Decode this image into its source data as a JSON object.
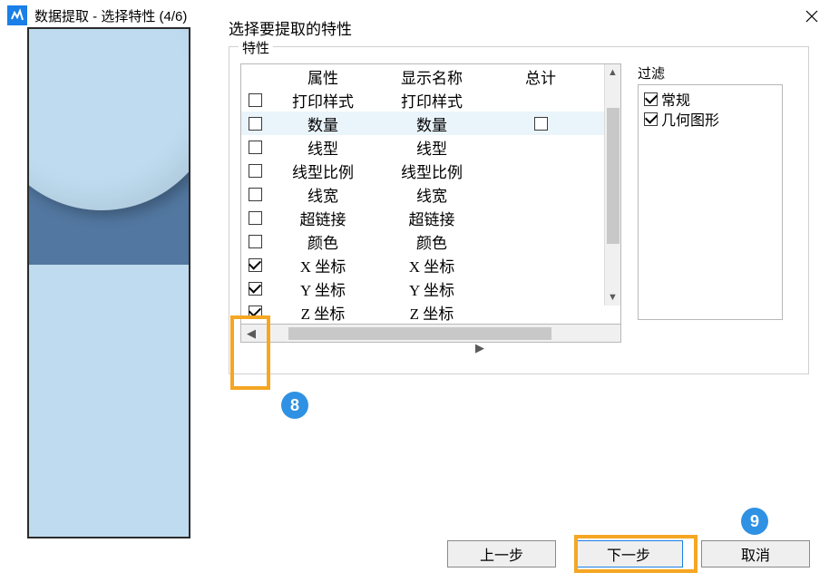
{
  "window": {
    "title": "数据提取 - 选择特性 (4/6)"
  },
  "instruction": "选择要提取的特性",
  "group_label": "特性",
  "table": {
    "headers": {
      "attr": "属性",
      "display": "显示名称",
      "total": "总计"
    },
    "rows": [
      {
        "checked": false,
        "attr": "打印样式",
        "display": "打印样式",
        "highlight": false,
        "show_total_box": false
      },
      {
        "checked": false,
        "attr": "数量",
        "display": "数量",
        "highlight": true,
        "show_total_box": true
      },
      {
        "checked": false,
        "attr": "线型",
        "display": "线型",
        "highlight": false,
        "show_total_box": false
      },
      {
        "checked": false,
        "attr": "线型比例",
        "display": "线型比例",
        "highlight": false,
        "show_total_box": false
      },
      {
        "checked": false,
        "attr": "线宽",
        "display": "线宽",
        "highlight": false,
        "show_total_box": false
      },
      {
        "checked": false,
        "attr": "超链接",
        "display": "超链接",
        "highlight": false,
        "show_total_box": false
      },
      {
        "checked": false,
        "attr": "颜色",
        "display": "颜色",
        "highlight": false,
        "show_total_box": false
      },
      {
        "checked": true,
        "attr": "X 坐标",
        "display": "X 坐标",
        "highlight": false,
        "show_total_box": false
      },
      {
        "checked": true,
        "attr": "Y 坐标",
        "display": "Y 坐标",
        "highlight": false,
        "show_total_box": false
      },
      {
        "checked": true,
        "attr": "Z 坐标",
        "display": "Z 坐标",
        "highlight": false,
        "show_total_box": false
      }
    ]
  },
  "filter": {
    "label": "过滤",
    "items": [
      {
        "checked": true,
        "label": "常规"
      },
      {
        "checked": true,
        "label": "几何图形"
      }
    ]
  },
  "buttons": {
    "prev": "上一步",
    "next": "下一步",
    "cancel": "取消"
  },
  "annotations": {
    "badge8": "8",
    "badge9": "9"
  }
}
